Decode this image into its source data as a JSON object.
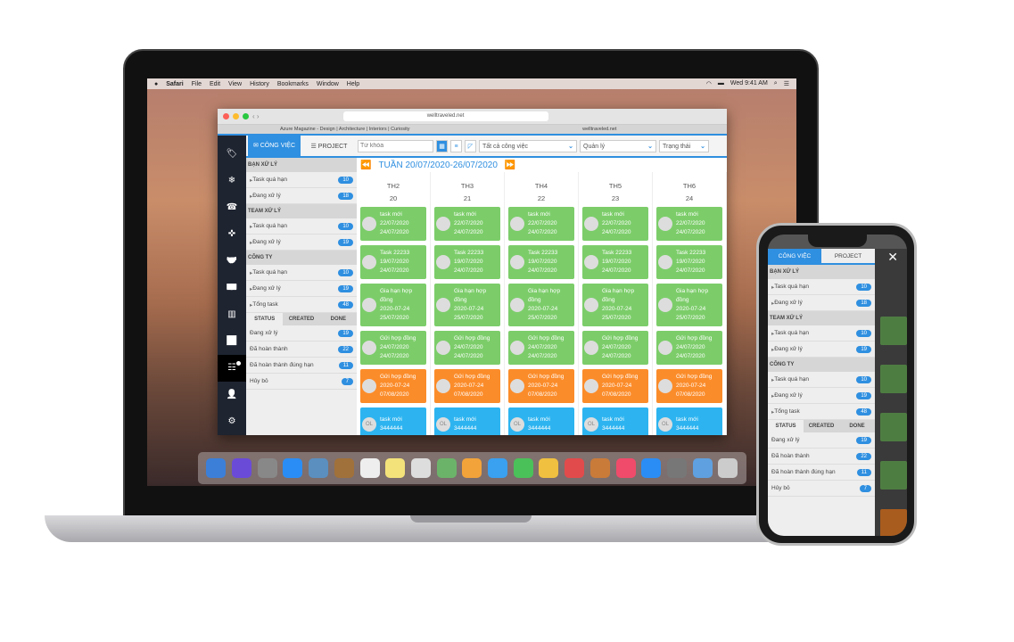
{
  "mac": {
    "menu": [
      "Safari",
      "File",
      "Edit",
      "View",
      "History",
      "Bookmarks",
      "Window",
      "Help"
    ],
    "clock": "Wed 9:41 AM"
  },
  "browser": {
    "url": "welltraveled.net",
    "tabs": [
      "Azure Magazine - Design | Architecture | Interiors | Curiosity",
      "welltraveled.net"
    ]
  },
  "app": {
    "tabs": {
      "cong_viec": "CÔNG VIỆC",
      "project": "PROJECT"
    },
    "search_placeholder": "Từ khóa",
    "filters": [
      "Tất cả công việc",
      "Quản lý",
      "Trạng thái"
    ],
    "week_label": "TUẦN 20/07/2020-26/07/2020",
    "sidebar_icons": [
      "tag-icon",
      "snowflake-icon",
      "phone-icon",
      "crosshair-icon",
      "handshake-icon",
      "money-icon",
      "bar-chart-icon",
      "line-chart-icon",
      "task-list-icon",
      "user-icon",
      "gear-icon"
    ],
    "groups": [
      {
        "title": "BẠN XỬ LÝ",
        "items": [
          {
            "label": "Task quá hạn",
            "count": "10"
          },
          {
            "label": "Đang xử lý",
            "count": "18"
          }
        ]
      },
      {
        "title": "TEAM XỬ LÝ",
        "items": [
          {
            "label": "Task quá hạn",
            "count": "10"
          },
          {
            "label": "Đang xử lý",
            "count": "19"
          }
        ]
      },
      {
        "title": "CÔNG TY",
        "items": [
          {
            "label": "Task quá hạn",
            "count": "10"
          },
          {
            "label": "Đang xử lý",
            "count": "19"
          },
          {
            "label": "Tổng task",
            "count": "48"
          }
        ]
      }
    ],
    "status_tabs": [
      "STATUS",
      "CREATED",
      "DONE"
    ],
    "status_items": [
      {
        "label": "Đang xử lý",
        "count": "19"
      },
      {
        "label": "Đã hoàn thành",
        "count": "22"
      },
      {
        "label": "Đã hoàn thành đúng hạn",
        "count": "11"
      },
      {
        "label": "Hủy bỏ",
        "count": "7"
      }
    ],
    "days": [
      {
        "name": "TH2",
        "date": "20"
      },
      {
        "name": "TH3",
        "date": "21"
      },
      {
        "name": "TH4",
        "date": "22"
      },
      {
        "name": "TH5",
        "date": "23"
      },
      {
        "name": "TH6",
        "date": "24"
      }
    ],
    "cards": [
      {
        "title": "task mới",
        "l1": "22/07/2020",
        "l2": "24/07/2020",
        "color": "#7ccd6a"
      },
      {
        "title": "Task 22233",
        "l1": "19/07/2020",
        "l2": "24/07/2020",
        "color": "#7ccd6a"
      },
      {
        "title": "Gia hạn hợp đồng",
        "l1": "2020-07-24",
        "l2": "25/07/2020",
        "color": "#7ccd6a",
        "tall": true
      },
      {
        "title": "Gửi hợp đồng",
        "l1": "24/07/2020",
        "l2": "24/07/2020",
        "color": "#7ccd6a"
      },
      {
        "title": "Gửi hợp đồng",
        "l1": "2020-07-24",
        "l2": "07/08/2020",
        "color": "#fb8c2a"
      },
      {
        "title": "task mới",
        "l1": "3444444",
        "l2": "",
        "color": "#2db4f0",
        "avatar": "OL"
      }
    ]
  },
  "colors": {
    "accent": "#2f8fe0",
    "green": "#7ccd6a",
    "orange": "#fb8c2a",
    "blue": "#2db4f0"
  }
}
